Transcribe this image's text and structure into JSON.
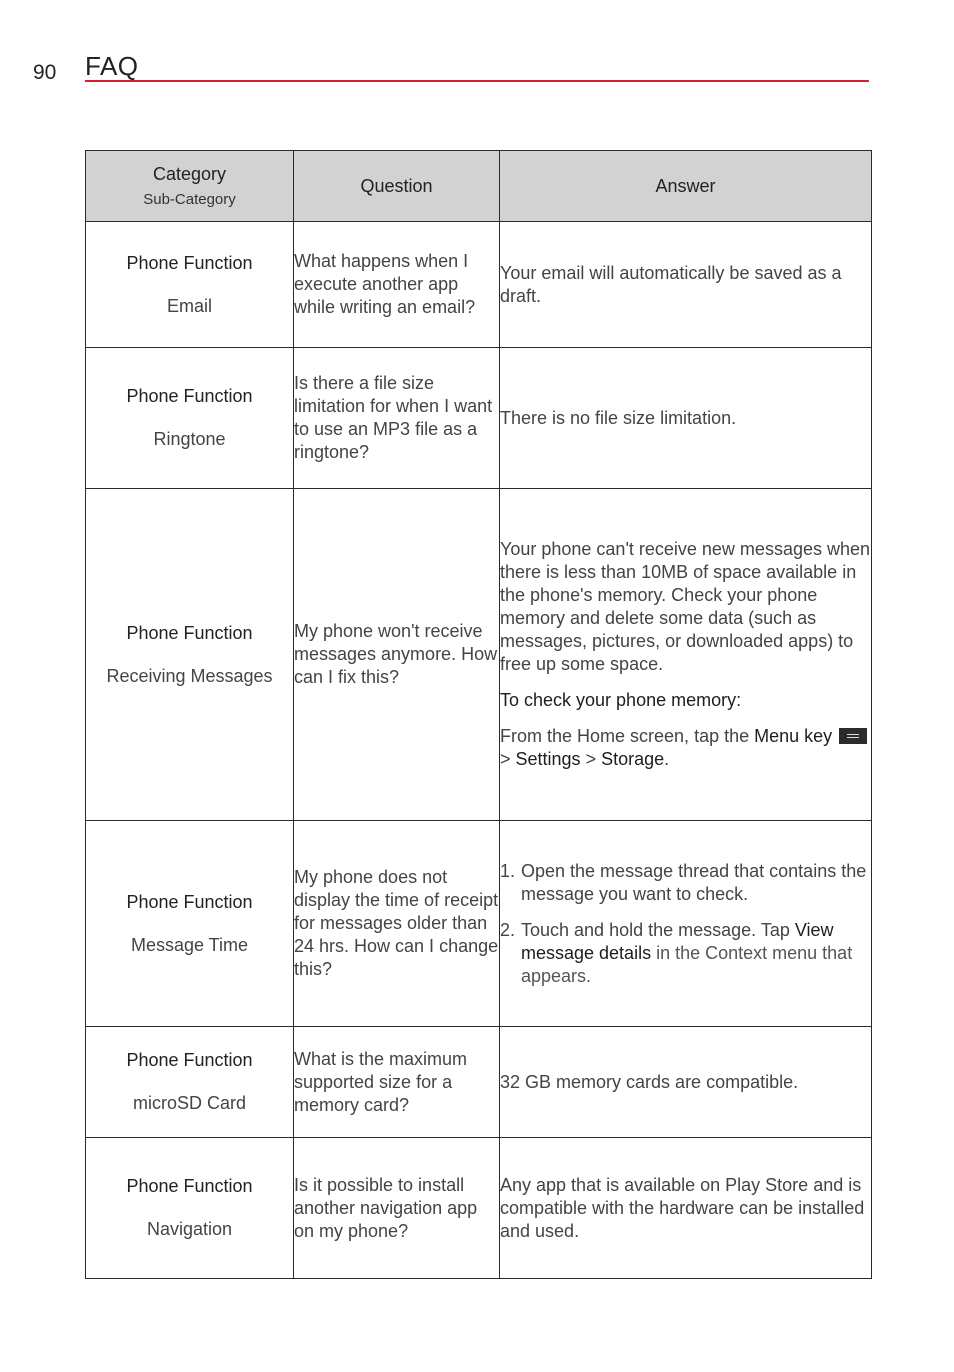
{
  "header": {
    "page_number": "90",
    "title": "FAQ",
    "accent_color": "#d3212f"
  },
  "table": {
    "columns": {
      "category": "Category",
      "sub_category": "Sub-Category",
      "question": "Question",
      "answer": "Answer"
    },
    "rows": [
      {
        "category": "Phone Function",
        "sub_category": "Email",
        "question": "What happens when I execute another app while writing an email?",
        "answer": "Your email will automatically be saved as a draft."
      },
      {
        "category": "Phone Function",
        "sub_category": "Ringtone",
        "question": "Is there a file size limitation for when I want to use an MP3 file as a ringtone?",
        "answer": "There is no file size limitation."
      },
      {
        "category": "Phone Function",
        "sub_category": "Receiving Messages",
        "question": "My phone won't receive messages anymore. How can I fix this?",
        "answer": "Your phone can't receive new messages when there is less than 10MB of space available in the phone's memory. Check your phone memory and delete some data (such as messages, pictures, or downloaded apps) to free up some space.",
        "answer_heading": "To check your phone memory:",
        "answer_steps": {
          "prefix": "From the Home screen, tap the ",
          "menu_key": "Menu key",
          "menu_key_icon": "menu-key-icon",
          "sep1": " > ",
          "settings": "Settings",
          "sep2": " > ",
          "storage": "Storage",
          "suffix": "."
        }
      },
      {
        "category": "Phone Function",
        "sub_category": "Message Time",
        "question": "My phone does not display the time of receipt for messages older than 24 hrs. How can I change this?",
        "answer_list": [
          {
            "num": "1.",
            "text": "Open the message thread that contains the message you want to check."
          },
          {
            "num": "2.",
            "prefix": "Touch and hold the message. Tap ",
            "bold": "View message details",
            "suffix": " in the Context menu that appears."
          }
        ]
      },
      {
        "category": "Phone Function",
        "sub_category": "microSD Card",
        "question": "What is the maximum supported size for a memory card?",
        "answer": "32 GB memory cards are compatible."
      },
      {
        "category": "Phone Function",
        "sub_category": "Navigation",
        "question": "Is it possible to install another navigation app on my phone?",
        "answer": "Any app that is available on Play Store and is compatible with the hardware can be installed and used."
      }
    ]
  }
}
